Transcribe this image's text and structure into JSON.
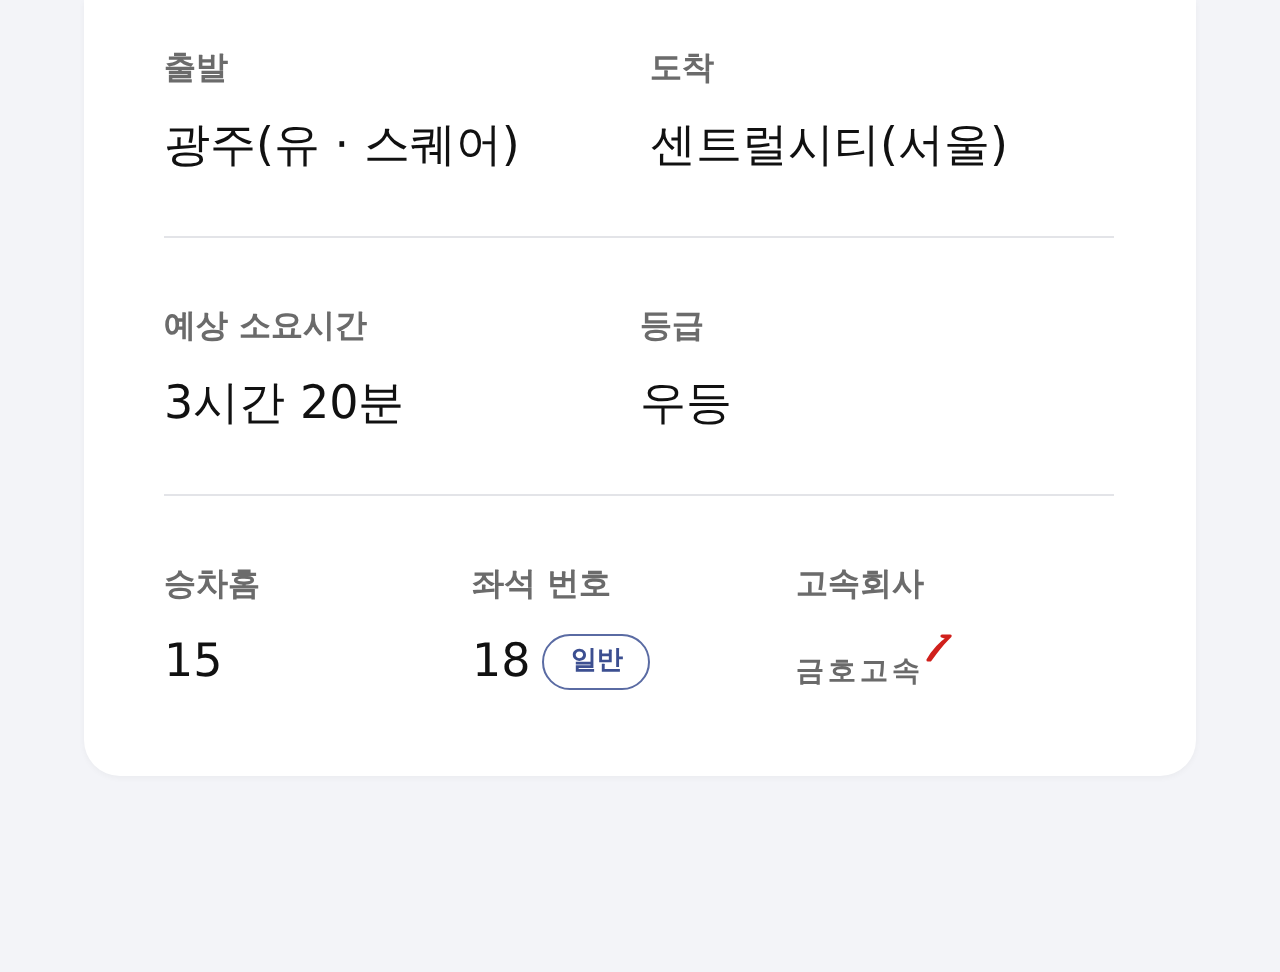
{
  "sections": [
    {
      "fields": [
        {
          "kind": "plain",
          "label": "출발",
          "value": "광주(유 · 스퀘어)"
        },
        {
          "kind": "plain",
          "label": "도착",
          "value": "센트럴시티(서울)"
        }
      ]
    },
    {
      "fields": [
        {
          "kind": "plain",
          "label": "예상 소요시간",
          "value": "3시간 20분"
        },
        {
          "kind": "plain",
          "label": "등급",
          "value": "우등"
        }
      ]
    },
    {
      "fields": [
        {
          "kind": "plain",
          "label": "승차홈",
          "value": "15"
        },
        {
          "kind": "seat",
          "label": "좌석 번호",
          "value": "18",
          "badge": "일반"
        },
        {
          "kind": "logo",
          "label": "고속회사",
          "value": "금호고속"
        }
      ]
    }
  ]
}
